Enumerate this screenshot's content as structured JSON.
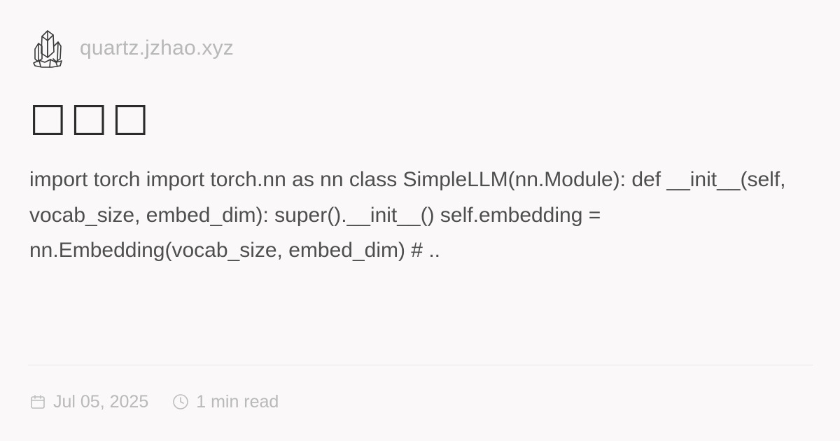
{
  "header": {
    "logo_icon": "crystal-logo-icon",
    "site_name": "quartz.jzhao.xyz"
  },
  "article": {
    "title": "□□□",
    "excerpt": "import torch import torch.nn as nn class SimpleLLM(nn.Module): def __init__(self, vocab_size, embed_dim): super().__init__() self.embedding = nn.Embedding(vocab_size, embed_dim) # .."
  },
  "meta": {
    "date_icon": "calendar-icon",
    "date": "Jul 05, 2025",
    "read_time_icon": "clock-icon",
    "read_time": "1 min read"
  },
  "colors": {
    "background": "#faf8f8",
    "title": "#2b2b2b",
    "body_text": "#4e4e4e",
    "muted": "#b9b9b9"
  }
}
